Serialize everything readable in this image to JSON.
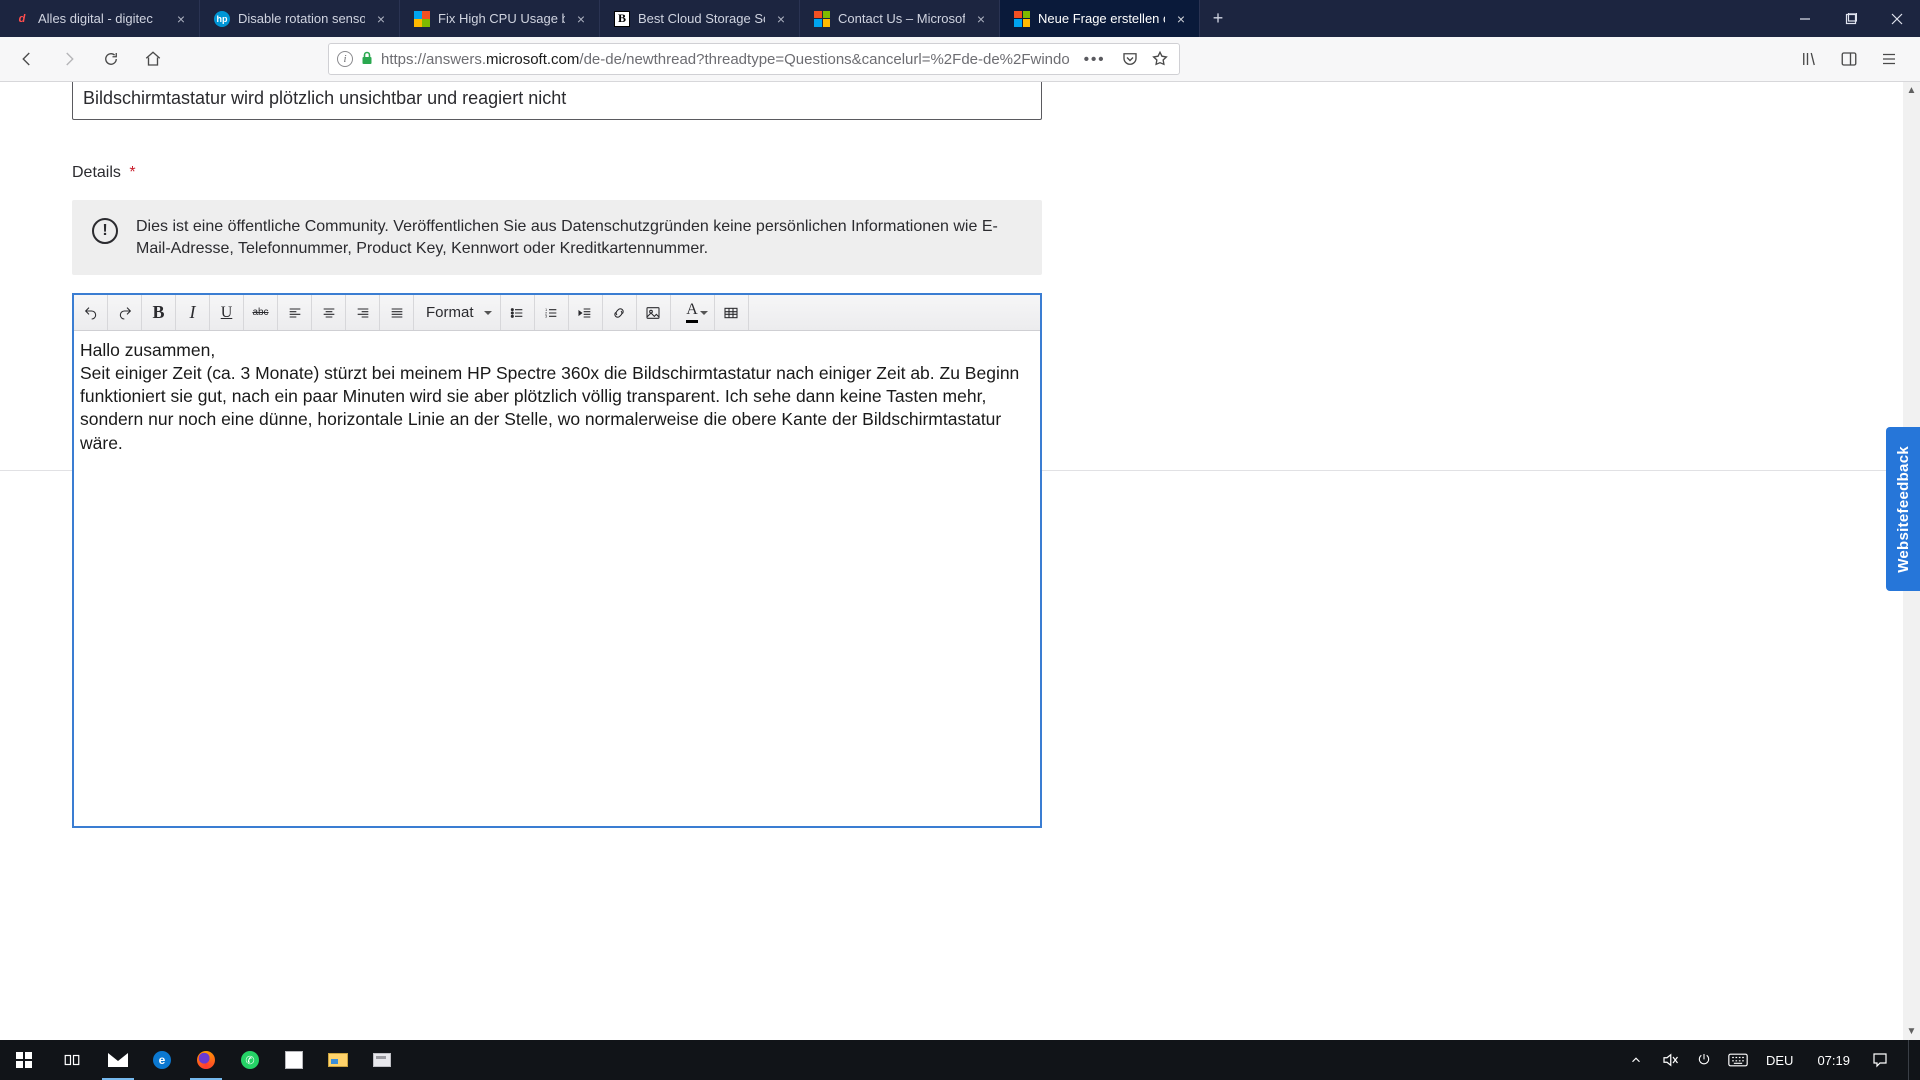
{
  "tabs": [
    {
      "title": "Alles digital - digitec"
    },
    {
      "title": "Disable rotation senso"
    },
    {
      "title": "Fix High CPU Usage b"
    },
    {
      "title": "Best Cloud Storage So"
    },
    {
      "title": "Contact Us – Microsof"
    },
    {
      "title": "Neue Frage erstellen o"
    }
  ],
  "url": {
    "prefix": "https://answers.",
    "host": "microsoft.com",
    "path": "/de-de/newthread?threadtype=Questions&cancelurl=%2Fde-de%2Fwindo"
  },
  "form": {
    "subject_value": "Bildschirmtastatur wird plötzlich unsichtbar und reagiert nicht",
    "details_label": "Details",
    "required_mark": "*",
    "notice": "Dies ist eine öffentliche Community. Veröffentlichen Sie aus Datenschutzgründen keine persönlichen Informationen wie E-Mail-Adresse, Telefonnummer, Product Key, Kennwort oder Kreditkartennummer.",
    "format_label": "Format",
    "body_line1": "Hallo zusammen,",
    "body_rest": "Seit einiger Zeit (ca. 3 Monate) stürzt bei meinem HP Spectre 360x die Bildschirmtastatur nach einiger Zeit ab. Zu Beginn funktioniert sie gut, nach ein paar Minuten wird sie aber plötzlich völlig transparent. Ich sehe dann keine Tasten mehr, sondern nur noch eine dünne, horizontale Linie an der Stelle, wo normalerweise die obere Kante der Bildschirmtastatur wäre."
  },
  "feedback_label": "Websitefeedback",
  "system": {
    "lang": "DEU",
    "time": "07:19"
  }
}
